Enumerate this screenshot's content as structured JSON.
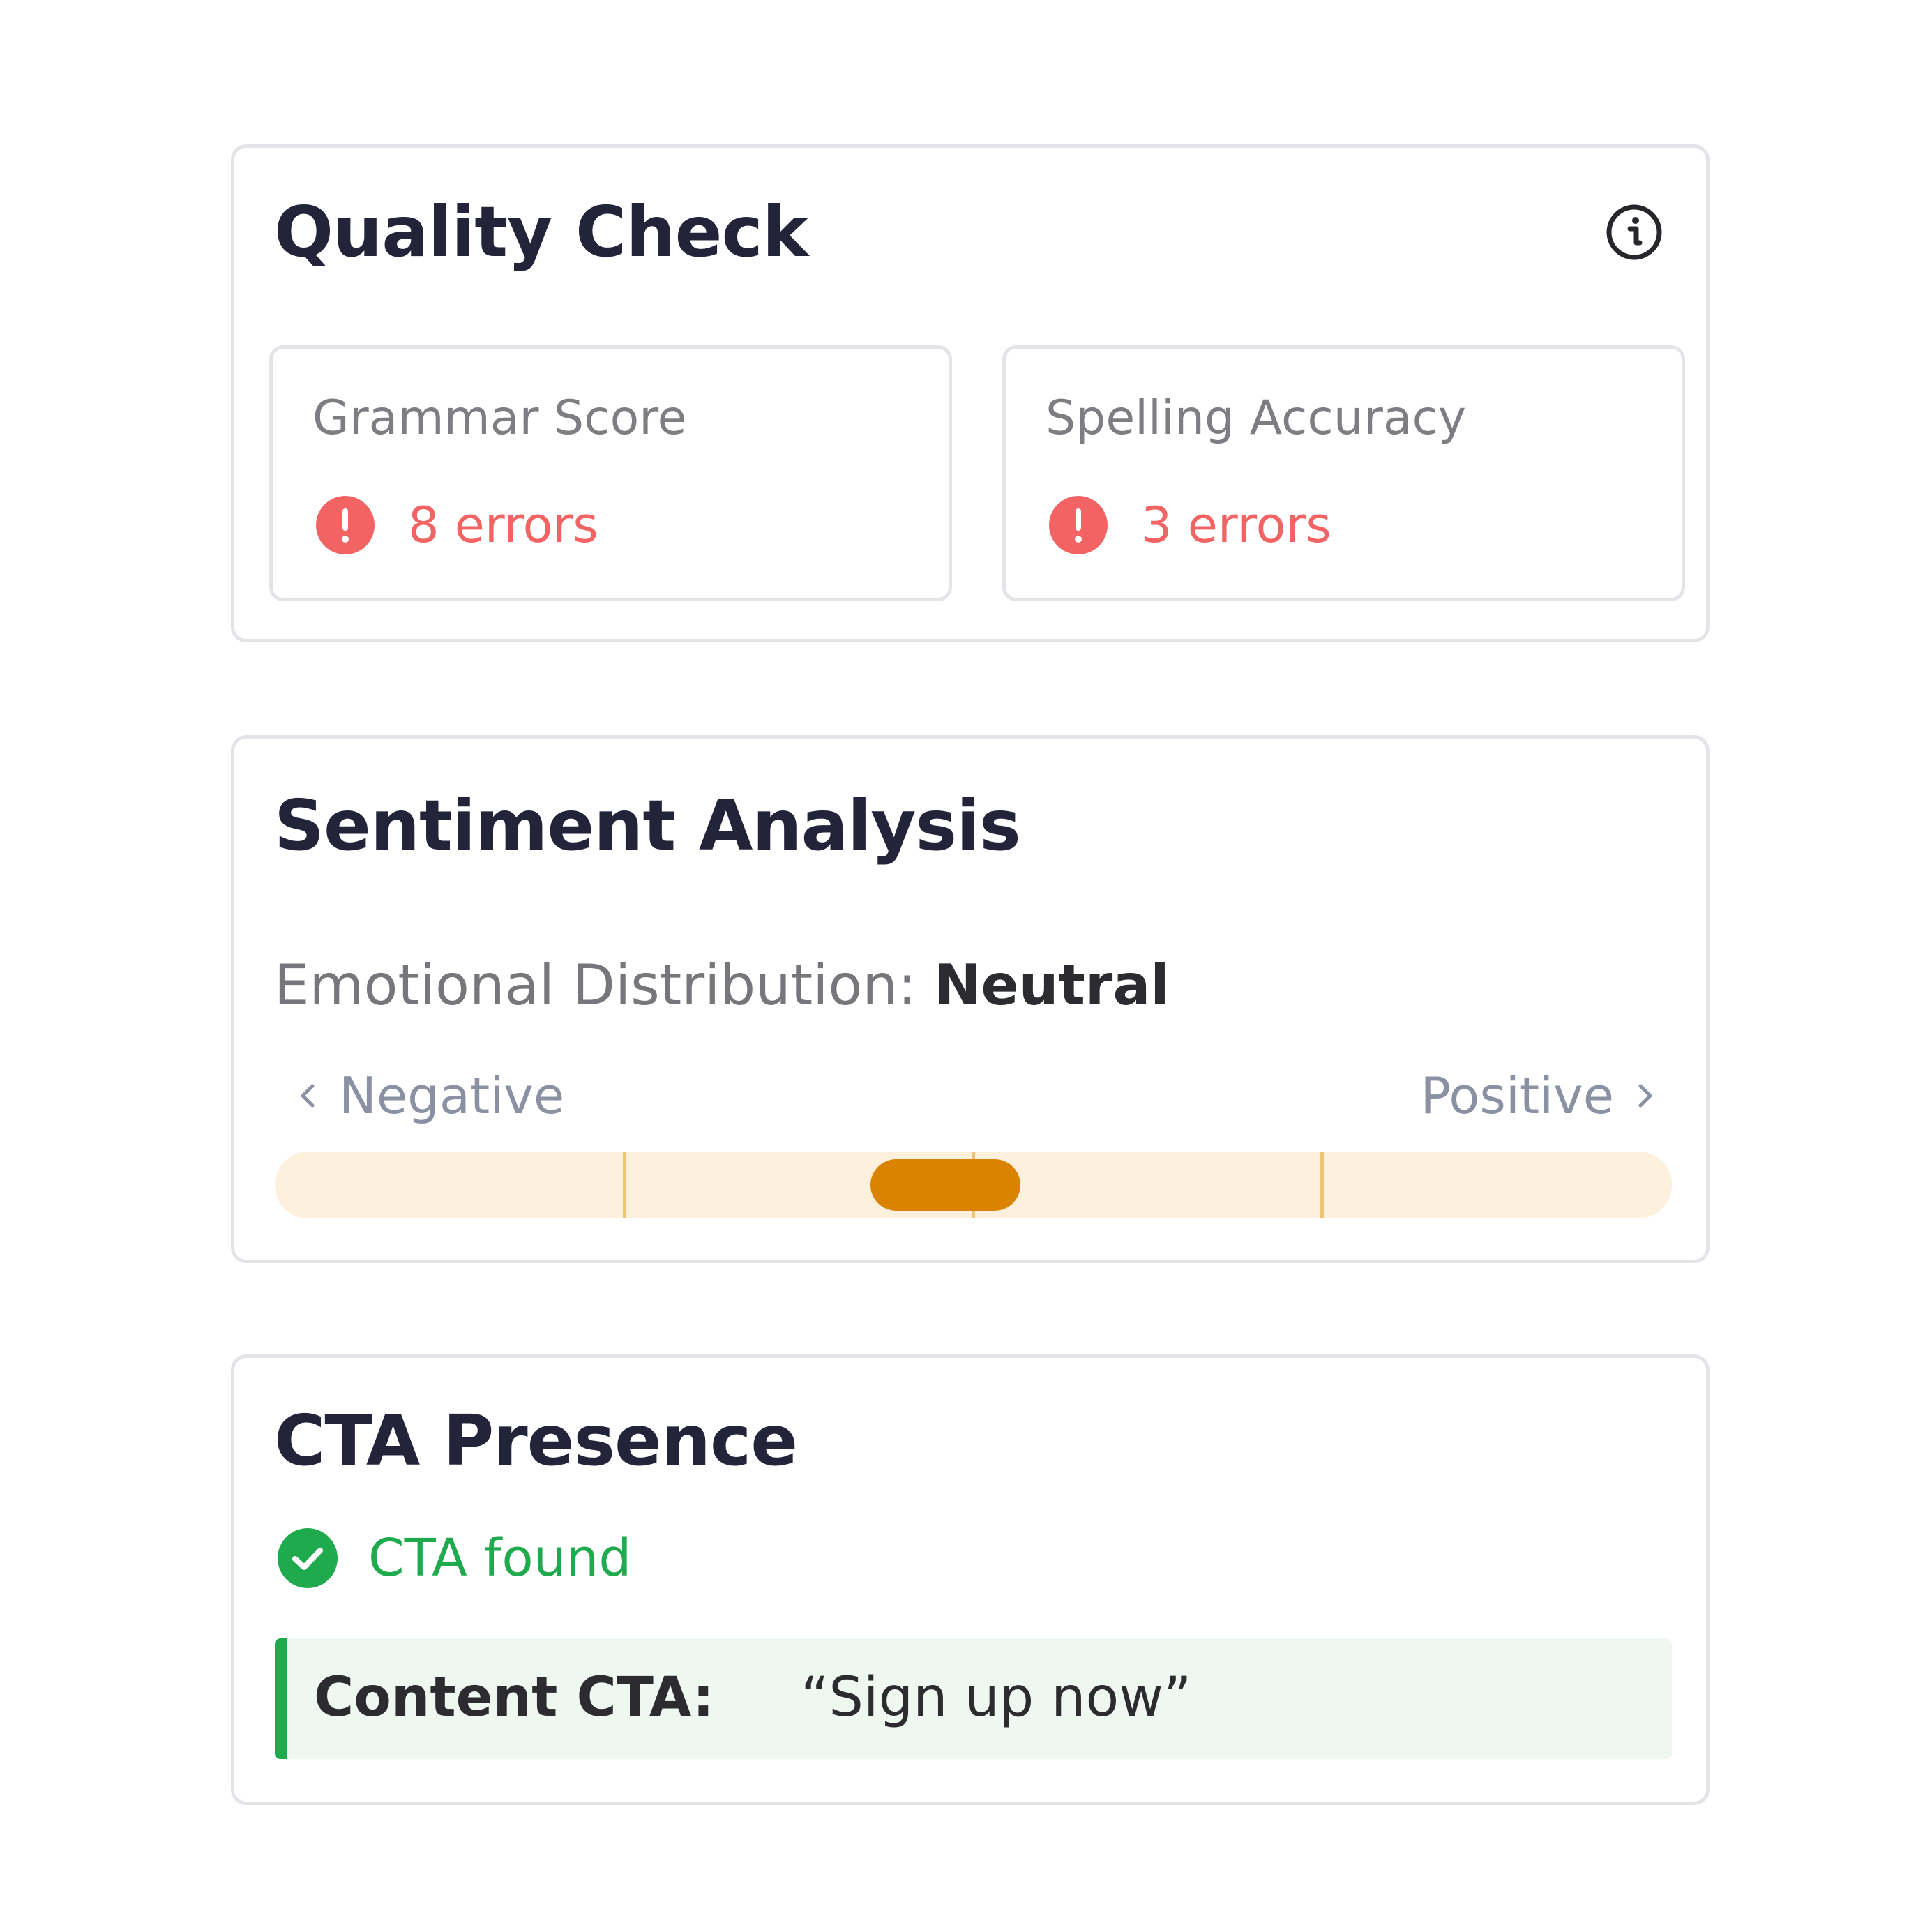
{
  "quality": {
    "title": "Quality Check",
    "info_icon": "info-icon",
    "grammar": {
      "label": "Grammar Score",
      "value": "8 errors",
      "icon": "error-icon"
    },
    "spelling": {
      "label": "Spelling Accuracy",
      "value": "3 errors",
      "icon": "error-icon"
    }
  },
  "sentiment": {
    "title": "Sentiment Analysis",
    "distribution_label": "Emotional Distribution:",
    "distribution_value": "Neutral",
    "negative_label": "Negative",
    "positive_label": "Positive",
    "level": 0.48
  },
  "cta": {
    "title": "CTA Presence",
    "status": "CTA found",
    "status_icon": "check-circle-icon",
    "content_label": "Content CTA:",
    "content_value": "“Sign up now”"
  },
  "colors": {
    "heading": "#23243a",
    "error": "#f26464",
    "success": "#1faa4d",
    "slider_track": "#fdf0dd",
    "slider_thumb": "#d98300",
    "slider_tick": "#f0c273",
    "cta_background": "#eef8f0",
    "border": "#e3e4e8"
  }
}
